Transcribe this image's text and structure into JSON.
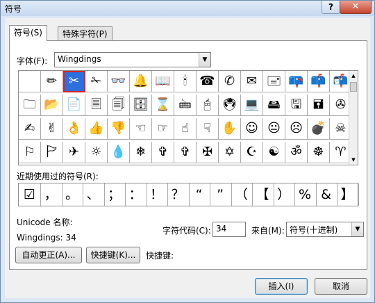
{
  "window": {
    "title": "符号",
    "help_label": "?",
    "close_label": "✕"
  },
  "tabs": [
    {
      "label": "符号(S)"
    },
    {
      "label": "特殊字符(P)"
    }
  ],
  "font": {
    "label": "字体(F):",
    "value": "Wingdings"
  },
  "symbols": [
    "",
    "✏",
    "✂",
    "✁",
    "👓",
    "🔔",
    "📖",
    "🕯",
    "☎",
    "✆",
    "✉",
    "🖃",
    "📪",
    "📫",
    "📬",
    "🗀",
    "📂",
    "📄",
    "🗏",
    "🗐",
    "🗄",
    "⌛",
    "🖮",
    "🖰",
    "🖲",
    "💻",
    "🖴",
    "🖫",
    "🖬",
    "✇",
    "✍",
    "✌",
    "👌",
    "👍",
    "👎",
    "☜",
    "☞",
    "☝",
    "☟",
    "✋",
    "☺",
    "😐",
    "☹",
    "💣",
    "☠",
    "⚐",
    "🏱",
    "✈",
    "☼",
    "💧",
    "❄",
    "✞",
    "✞",
    "✠",
    "✡",
    "☪",
    "☯",
    "ॐ",
    "☸",
    "♈",
    "♉"
  ],
  "recent": {
    "label": "近期使用过的符号(R):",
    "items": [
      "☑",
      "，",
      "。",
      "、",
      "；",
      "：",
      "！",
      "？",
      "“",
      "”",
      "（",
      "【",
      "）",
      "%",
      "&",
      "】"
    ]
  },
  "unicode_name_label": "Unicode 名称:",
  "symbol_name": "Wingdings: 34",
  "char_code": {
    "label": "字符代码(C):",
    "value": "34"
  },
  "from": {
    "label": "来自(M):",
    "value": "符号(十进制)"
  },
  "buttons": {
    "autocorrect": "自动更正(A)...",
    "shortcut_key": "快捷键(K)...",
    "insert": "插入(I)",
    "cancel": "取消"
  },
  "shortcut_label": "快捷键:"
}
